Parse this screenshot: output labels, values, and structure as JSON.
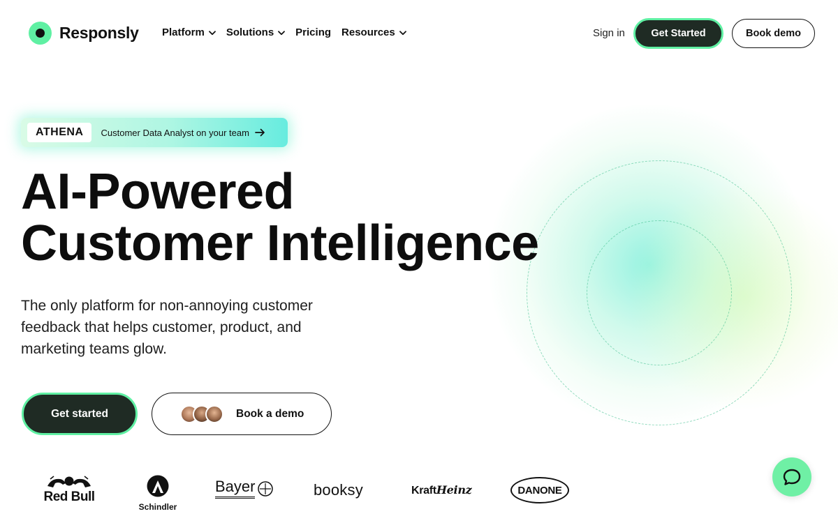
{
  "brand": {
    "name": "Responsly",
    "accent": "#5ff0a3",
    "dark": "#1f2b24"
  },
  "nav": {
    "items": [
      {
        "label": "Platform",
        "has_dropdown": true
      },
      {
        "label": "Solutions",
        "has_dropdown": true
      },
      {
        "label": "Pricing",
        "has_dropdown": false
      },
      {
        "label": "Resources",
        "has_dropdown": true
      }
    ],
    "sign_in": "Sign in",
    "get_started": "Get Started",
    "book_demo": "Book demo"
  },
  "announcement": {
    "tag": "ATHENA",
    "text": "Customer Data Analyst  on your team",
    "icon": "arrow-right-icon"
  },
  "hero": {
    "title_line1": "AI-Powered",
    "title_line2": "Customer Intelligence",
    "subtitle": "The only platform for non-annoying customer feedback that helps customer, product, and marketing teams glow.",
    "cta_primary": "Get started",
    "cta_secondary": "Book a demo"
  },
  "logos": [
    {
      "name": "Red Bull",
      "label": "Red Bull"
    },
    {
      "name": "Schindler",
      "label": "Schindler"
    },
    {
      "name": "Bayer",
      "label": "Bayer"
    },
    {
      "name": "booksy",
      "label": "booksy"
    },
    {
      "name": "KraftHeinz",
      "label_a": "Kraft",
      "label_b": "Heinz"
    },
    {
      "name": "Danone",
      "label": "DANONE"
    }
  ],
  "chat": {
    "icon": "chat-bubble-icon"
  }
}
